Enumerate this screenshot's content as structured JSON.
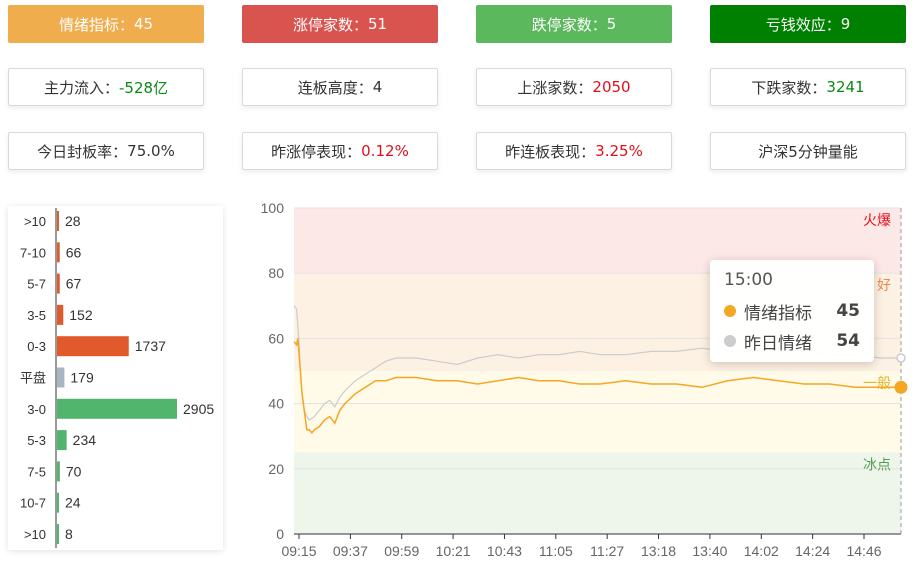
{
  "cards": [
    {
      "label": "情绪指标：",
      "value": "45",
      "style": "solid",
      "bg": "#f0ad4e",
      "valueColor": ""
    },
    {
      "label": "涨停家数：",
      "value": "51",
      "style": "solid",
      "bg": "#d9534f",
      "valueColor": ""
    },
    {
      "label": "跌停家数：",
      "value": "5",
      "style": "solid",
      "bg": "#5cb85c",
      "valueColor": ""
    },
    {
      "label": "亏钱效应：",
      "value": "9",
      "style": "solid",
      "bg": "#008000",
      "valueColor": ""
    },
    {
      "label": "主力流入：",
      "value": "-528亿",
      "style": "outline",
      "bg": "",
      "valueColor": "green"
    },
    {
      "label": "连板高度：",
      "value": "4",
      "style": "outline",
      "bg": "",
      "valueColor": ""
    },
    {
      "label": "上涨家数：",
      "value": "2050",
      "style": "outline",
      "bg": "",
      "valueColor": "red"
    },
    {
      "label": "下跌家数：",
      "value": "3241",
      "style": "outline",
      "bg": "",
      "valueColor": "green"
    },
    {
      "label": "今日封板率：",
      "value": "75.0%",
      "style": "outline",
      "bg": "",
      "valueColor": ""
    },
    {
      "label": "昨涨停表现：",
      "value": "0.12%",
      "style": "outline",
      "bg": "",
      "valueColor": "red"
    },
    {
      "label": "昨连板表现：",
      "value": "3.25%",
      "style": "outline",
      "bg": "",
      "valueColor": "red"
    },
    {
      "label": "沪深5分钟量能",
      "value": "",
      "style": "outline",
      "bg": "",
      "valueColor": ""
    }
  ],
  "distribution": {
    "rows": [
      {
        "label": ">10",
        "value": 28,
        "color": "#e05a2b"
      },
      {
        "label": "7-10",
        "value": 66,
        "color": "#e05a2b"
      },
      {
        "label": "5-7",
        "value": 67,
        "color": "#e05a2b"
      },
      {
        "label": "3-5",
        "value": 152,
        "color": "#e05a2b"
      },
      {
        "label": "0-3",
        "value": 1737,
        "color": "#e05a2b"
      },
      {
        "label": "平盘",
        "value": 179,
        "color": "#a9b4c2"
      },
      {
        "label": "3-0",
        "value": 2905,
        "color": "#52b56d"
      },
      {
        "label": "5-3",
        "value": 234,
        "color": "#52b56d"
      },
      {
        "label": "7-5",
        "value": 70,
        "color": "#52b56d"
      },
      {
        "label": "10-7",
        "value": 24,
        "color": "#52b56d"
      },
      {
        "label": ">10",
        "value": 8,
        "color": "#52b56d"
      }
    ]
  },
  "chart_data": {
    "type": "line",
    "ylim": [
      0,
      100
    ],
    "yticks": [
      "0",
      "20",
      "40",
      "60",
      "80",
      "100"
    ],
    "xticks": [
      "09:15",
      "09:37",
      "09:59",
      "10:21",
      "10:43",
      "11:05",
      "11:27",
      "13:18",
      "13:40",
      "14:02",
      "14:24",
      "14:46"
    ],
    "zones": [
      {
        "name": "火爆",
        "from": 80,
        "to": 100,
        "fill": "#fde8e8",
        "textColor": "#e0101a"
      },
      {
        "name": "好",
        "from": 50,
        "to": 80,
        "fill": "#fdf1e3",
        "textColor": "#f08a4b"
      },
      {
        "name": "一般",
        "from": 25,
        "to": 50,
        "fill": "#fffbe8",
        "textColor": "#e6b422"
      },
      {
        "name": "冰点",
        "from": 0,
        "to": 25,
        "fill": "#eef6ec",
        "textColor": "#52a050"
      }
    ],
    "series": [
      {
        "name": "情绪指标",
        "color": "#f5a623",
        "x": [
          0,
          1,
          1.5,
          2,
          2.5,
          3,
          4,
          5,
          6,
          7,
          8,
          10,
          12,
          14,
          16,
          18,
          20,
          24,
          28,
          32,
          36,
          40,
          48,
          56,
          64,
          72,
          80,
          88,
          96,
          104,
          112,
          120,
          130,
          140,
          150,
          160,
          170,
          180,
          190,
          200,
          210,
          220,
          230,
          238
        ],
        "values": [
          59,
          58,
          60,
          55,
          50,
          44,
          38,
          32,
          32,
          31,
          32,
          33,
          35,
          36,
          34,
          38,
          40,
          43,
          45,
          47,
          47,
          48,
          48,
          47,
          47,
          46,
          47,
          48,
          47,
          47,
          46,
          46,
          47,
          46,
          46,
          45,
          47,
          48,
          47,
          46,
          46,
          45,
          45,
          45
        ]
      },
      {
        "name": "昨日情绪",
        "color": "#cccccc",
        "x": [
          0,
          1,
          1.5,
          2,
          2.5,
          3,
          4,
          5,
          6,
          8,
          10,
          12,
          14,
          16,
          18,
          20,
          24,
          28,
          32,
          36,
          40,
          48,
          56,
          64,
          72,
          80,
          88,
          96,
          104,
          112,
          120,
          130,
          140,
          150,
          160,
          170,
          180,
          190,
          200,
          210,
          220,
          230,
          238
        ],
        "values": [
          70,
          69,
          64,
          58,
          50,
          44,
          38,
          36,
          35,
          36,
          38,
          40,
          41,
          39,
          42,
          44,
          47,
          49,
          51,
          53,
          54,
          54,
          53,
          52,
          54,
          55,
          54,
          55,
          55,
          56,
          55,
          55,
          56,
          56,
          57,
          56,
          56,
          57,
          56,
          55,
          55,
          54,
          54
        ]
      }
    ],
    "tooltip": {
      "time": "15:00",
      "rows": [
        {
          "name": "情绪指标",
          "value": "45",
          "color": "#f5a623"
        },
        {
          "name": "昨日情绪",
          "value": "54",
          "color": "#cccccc"
        }
      ]
    }
  }
}
